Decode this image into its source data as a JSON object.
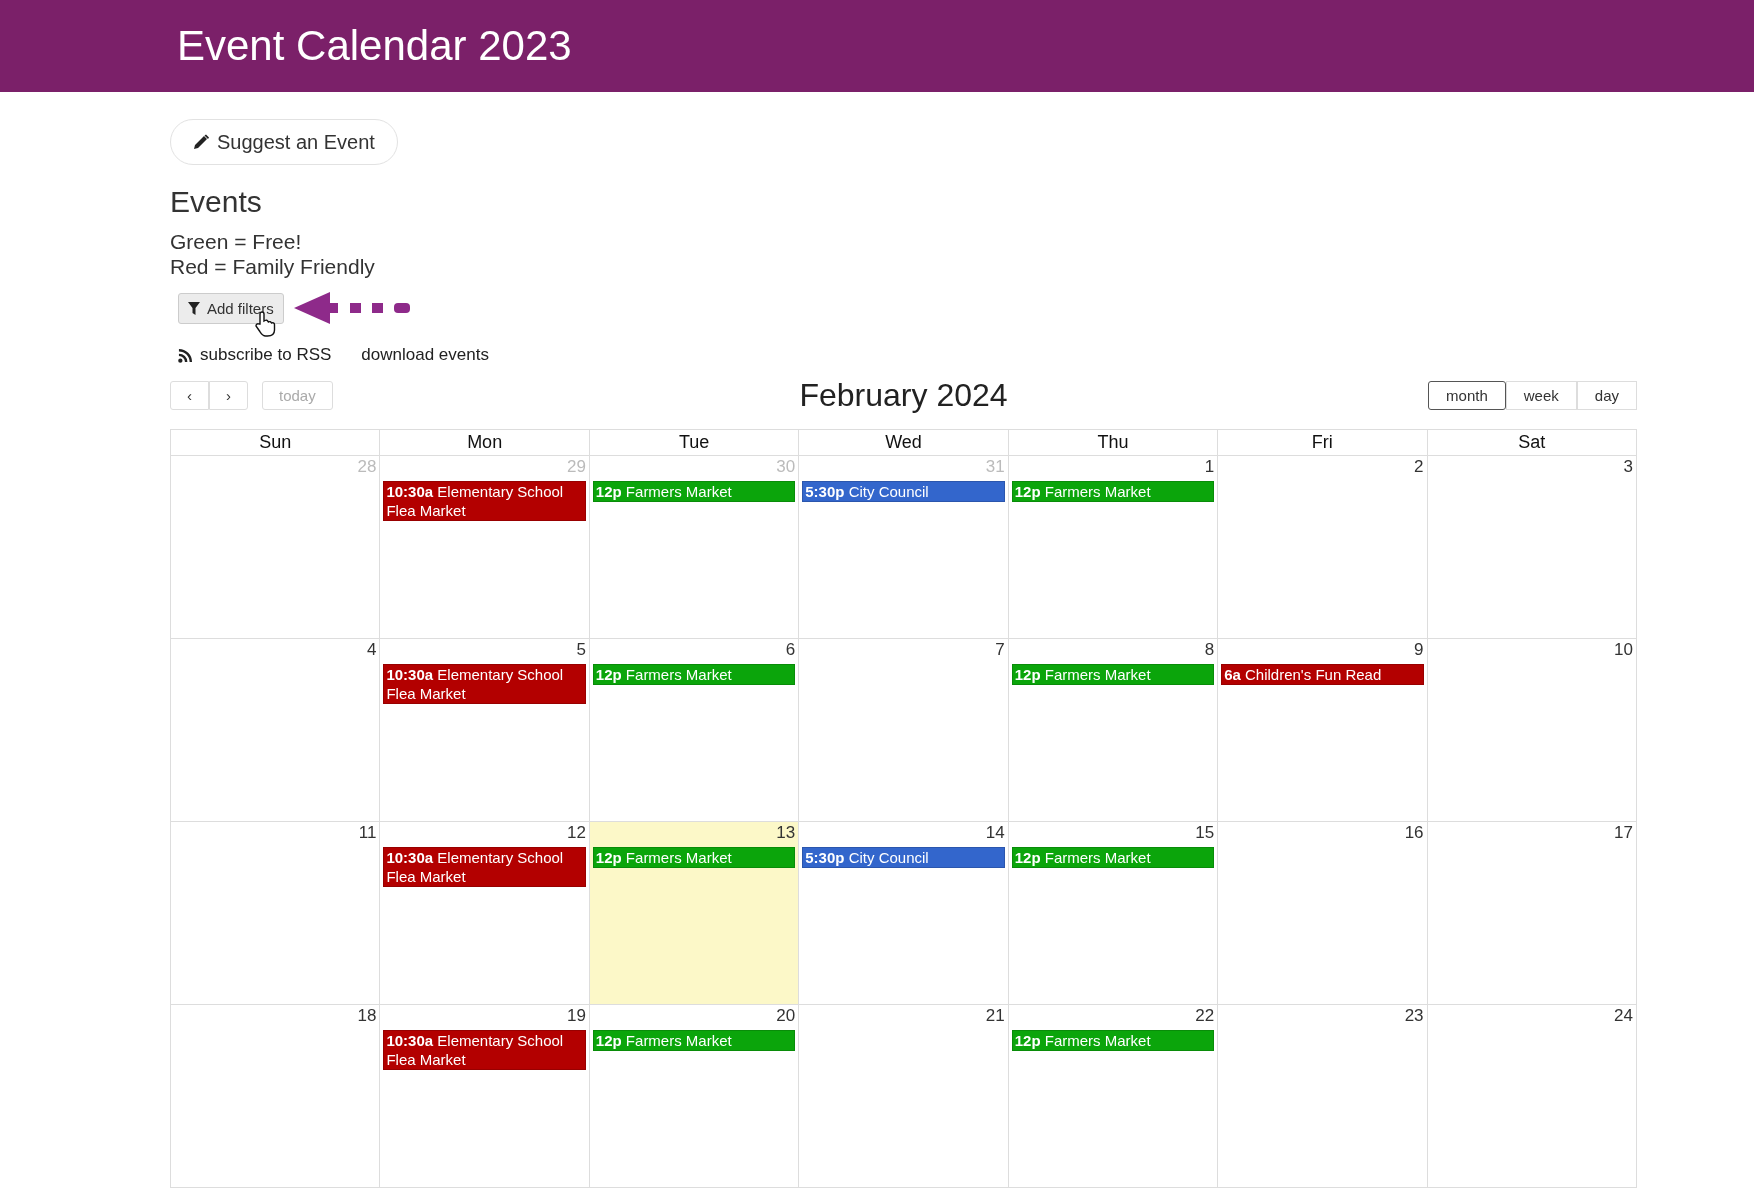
{
  "header": {
    "title": "Event Calendar 2023"
  },
  "suggest_button": "Suggest an Event",
  "section_title": "Events",
  "legend": [
    "Green = Free!",
    "Red = Family Friendly"
  ],
  "filter_button": "Add filters",
  "links": [
    {
      "label": "subscribe to RSS",
      "kind": "rss"
    },
    {
      "label": "download events",
      "kind": "plain"
    }
  ],
  "toolbar": {
    "prev": "‹",
    "next": "›",
    "today": {
      "label": "today",
      "disabled": true
    },
    "title": "February 2024",
    "views": [
      {
        "label": "month",
        "selected": true
      },
      {
        "label": "week",
        "selected": false
      },
      {
        "label": "day",
        "selected": false
      }
    ]
  },
  "calendar": {
    "weekdays": [
      "Sun",
      "Mon",
      "Tue",
      "Wed",
      "Thu",
      "Fri",
      "Sat"
    ],
    "weeks": [
      [
        {
          "day": "28",
          "other_month": true,
          "today": false
        },
        {
          "day": "29",
          "other_month": true,
          "today": false,
          "events": [
            {
              "time": "10:30a",
              "title": "Elementary School Flea Market",
              "color": "#b30000"
            }
          ]
        },
        {
          "day": "30",
          "other_month": true,
          "today": false,
          "events": [
            {
              "time": "12p",
              "title": "Farmers Market",
              "color": "#0ba50b"
            }
          ]
        },
        {
          "day": "31",
          "other_month": true,
          "today": false,
          "events": [
            {
              "time": "5:30p",
              "title": "City Council",
              "color": "#3366cc"
            }
          ]
        },
        {
          "day": "1",
          "other_month": false,
          "today": false,
          "events": [
            {
              "time": "12p",
              "title": "Farmers Market",
              "color": "#0ba50b"
            }
          ]
        },
        {
          "day": "2",
          "other_month": false,
          "today": false
        },
        {
          "day": "3",
          "other_month": false,
          "today": false
        }
      ],
      [
        {
          "day": "4",
          "other_month": false,
          "today": false
        },
        {
          "day": "5",
          "other_month": false,
          "today": false,
          "events": [
            {
              "time": "10:30a",
              "title": "Elementary School Flea Market",
              "color": "#b30000"
            }
          ]
        },
        {
          "day": "6",
          "other_month": false,
          "today": false,
          "events": [
            {
              "time": "12p",
              "title": "Farmers Market",
              "color": "#0ba50b"
            }
          ]
        },
        {
          "day": "7",
          "other_month": false,
          "today": false
        },
        {
          "day": "8",
          "other_month": false,
          "today": false,
          "events": [
            {
              "time": "12p",
              "title": "Farmers Market",
              "color": "#0ba50b"
            }
          ]
        },
        {
          "day": "9",
          "other_month": false,
          "today": false,
          "events": [
            {
              "time": "6a",
              "title": "Children's Fun Read",
              "color": "#b30000"
            }
          ]
        },
        {
          "day": "10",
          "other_month": false,
          "today": false
        }
      ],
      [
        {
          "day": "11",
          "other_month": false,
          "today": false
        },
        {
          "day": "12",
          "other_month": false,
          "today": false,
          "events": [
            {
              "time": "10:30a",
              "title": "Elementary School Flea Market",
              "color": "#b30000"
            }
          ]
        },
        {
          "day": "13",
          "other_month": false,
          "today": true,
          "events": [
            {
              "time": "12p",
              "title": "Farmers Market",
              "color": "#0ba50b"
            }
          ]
        },
        {
          "day": "14",
          "other_month": false,
          "today": false,
          "events": [
            {
              "time": "5:30p",
              "title": "City Council",
              "color": "#3366cc"
            }
          ]
        },
        {
          "day": "15",
          "other_month": false,
          "today": false,
          "events": [
            {
              "time": "12p",
              "title": "Farmers Market",
              "color": "#0ba50b"
            }
          ]
        },
        {
          "day": "16",
          "other_month": false,
          "today": false
        },
        {
          "day": "17",
          "other_month": false,
          "today": false
        }
      ],
      [
        {
          "day": "18",
          "other_month": false,
          "today": false
        },
        {
          "day": "19",
          "other_month": false,
          "today": false,
          "events": [
            {
              "time": "10:30a",
              "title": "Elementary School Flea Market",
              "color": "#b30000"
            }
          ]
        },
        {
          "day": "20",
          "other_month": false,
          "today": false,
          "events": [
            {
              "time": "12p",
              "title": "Farmers Market",
              "color": "#0ba50b"
            }
          ]
        },
        {
          "day": "21",
          "other_month": false,
          "today": false
        },
        {
          "day": "22",
          "other_month": false,
          "today": false,
          "events": [
            {
              "time": "12p",
              "title": "Farmers Market",
              "color": "#0ba50b"
            }
          ]
        },
        {
          "day": "23",
          "other_month": false,
          "today": false
        },
        {
          "day": "24",
          "other_month": false,
          "today": false
        }
      ]
    ]
  }
}
